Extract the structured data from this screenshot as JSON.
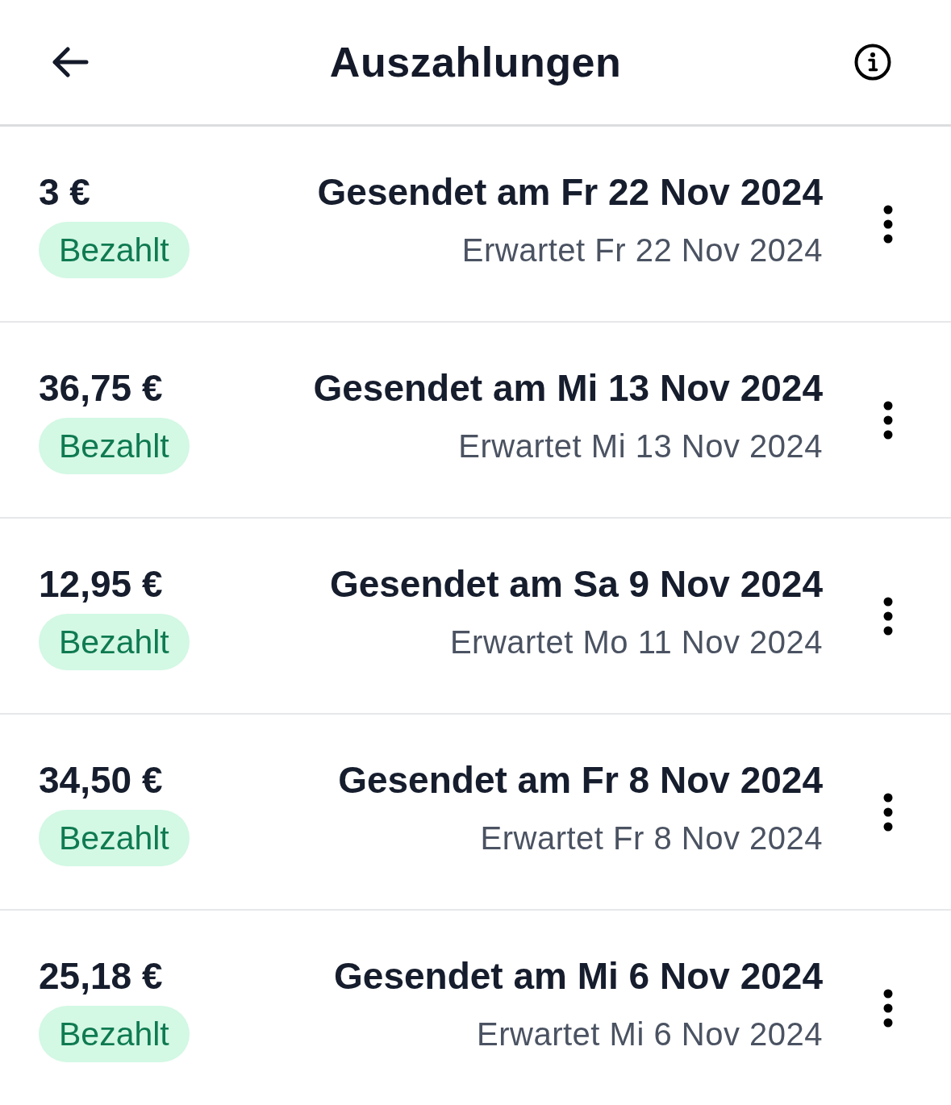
{
  "header": {
    "title": "Auszahlungen"
  },
  "payouts": [
    {
      "amount": "3 €",
      "status": "Bezahlt",
      "sent": "Gesendet am Fr 22 Nov 2024",
      "expected": "Erwartet Fr 22 Nov 2024"
    },
    {
      "amount": "36,75 €",
      "status": "Bezahlt",
      "sent": "Gesendet am Mi 13 Nov 2024",
      "expected": "Erwartet Mi 13 Nov 2024"
    },
    {
      "amount": "12,95 €",
      "status": "Bezahlt",
      "sent": "Gesendet am Sa 9 Nov 2024",
      "expected": "Erwartet Mo 11 Nov 2024"
    },
    {
      "amount": "34,50 €",
      "status": "Bezahlt",
      "sent": "Gesendet am Fr 8 Nov 2024",
      "expected": "Erwartet Fr 8 Nov 2024"
    },
    {
      "amount": "25,18 €",
      "status": "Bezahlt",
      "sent": "Gesendet am Mi 6 Nov 2024",
      "expected": "Erwartet Mi 6 Nov 2024"
    }
  ]
}
